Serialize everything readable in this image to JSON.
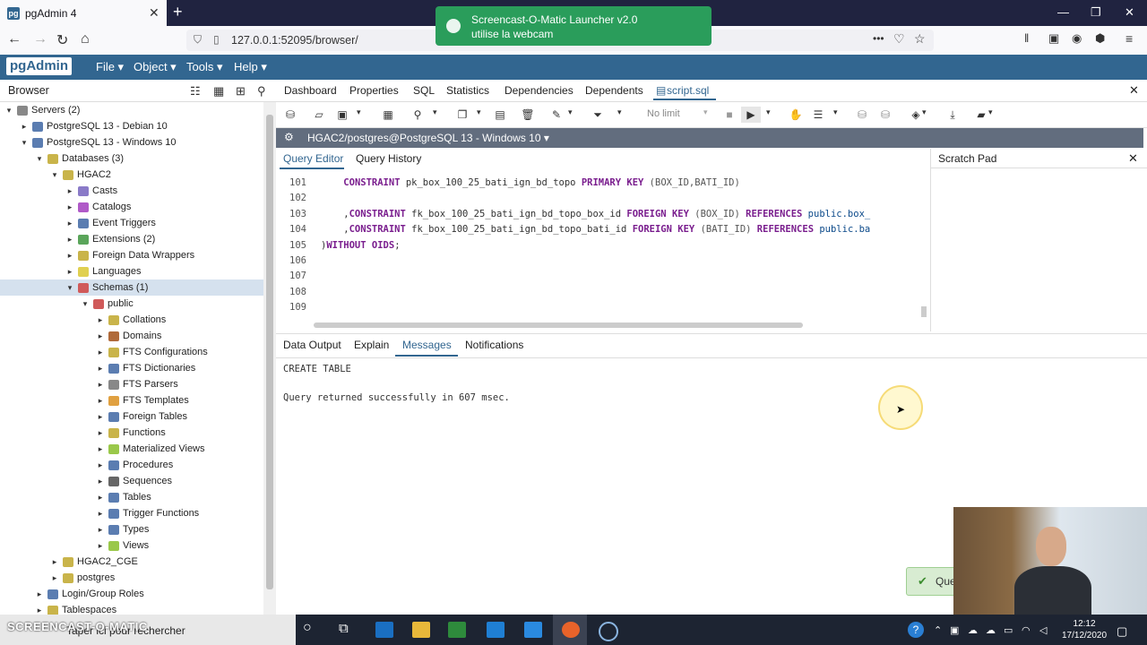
{
  "firefox": {
    "tab_title": "pgAdmin 4",
    "tab_favicon": "pg",
    "url": "127.0.0.1:52095/browser/",
    "more": "•••"
  },
  "notification": {
    "line1": "Screencast-O-Matic Launcher v2.0",
    "line2": "utilise la webcam"
  },
  "pgadmin": {
    "logo_left": "pg",
    "logo_right": "Admin",
    "menu": [
      "File ▾",
      "Object ▾",
      "Tools ▾",
      "Help ▾"
    ]
  },
  "browser": {
    "title": "Browser",
    "tree": [
      {
        "label": "Servers (2)",
        "toggle": "▾",
        "indent": 0,
        "color": "#888"
      },
      {
        "label": "PostgreSQL 13 - Debian 10",
        "toggle": "▸",
        "indent": 1,
        "color": "#5b7db1"
      },
      {
        "label": "PostgreSQL 13 - Windows 10",
        "toggle": "▾",
        "indent": 1,
        "color": "#5b7db1"
      },
      {
        "label": "Databases (3)",
        "toggle": "▾",
        "indent": 2,
        "color": "#c9b44a"
      },
      {
        "label": "HGAC2",
        "toggle": "▾",
        "indent": 3,
        "color": "#c9b44a"
      },
      {
        "label": "Casts",
        "toggle": "▸",
        "indent": 4,
        "color": "#8a7ac8"
      },
      {
        "label": "Catalogs",
        "toggle": "▸",
        "indent": 4,
        "color": "#b05ac8"
      },
      {
        "label": "Event Triggers",
        "toggle": "▸",
        "indent": 4,
        "color": "#5b7db1"
      },
      {
        "label": "Extensions (2)",
        "toggle": "▸",
        "indent": 4,
        "color": "#5aa55a"
      },
      {
        "label": "Foreign Data Wrappers",
        "toggle": "▸",
        "indent": 4,
        "color": "#c9b44a"
      },
      {
        "label": "Languages",
        "toggle": "▸",
        "indent": 4,
        "color": "#e0d050"
      },
      {
        "label": "Schemas (1)",
        "toggle": "▾",
        "indent": 4,
        "color": "#d05a5a",
        "selected": true
      },
      {
        "label": "public",
        "toggle": "▾",
        "indent": 5,
        "color": "#d05a5a"
      },
      {
        "label": "Collations",
        "toggle": "▸",
        "indent": 6,
        "color": "#c9b44a"
      },
      {
        "label": "Domains",
        "toggle": "▸",
        "indent": 6,
        "color": "#b06a3a"
      },
      {
        "label": "FTS Configurations",
        "toggle": "▸",
        "indent": 6,
        "color": "#c9b44a"
      },
      {
        "label": "FTS Dictionaries",
        "toggle": "▸",
        "indent": 6,
        "color": "#5b7db1"
      },
      {
        "label": "FTS Parsers",
        "toggle": "▸",
        "indent": 6,
        "color": "#888"
      },
      {
        "label": "FTS Templates",
        "toggle": "▸",
        "indent": 6,
        "color": "#e0a040"
      },
      {
        "label": "Foreign Tables",
        "toggle": "▸",
        "indent": 6,
        "color": "#5b7db1"
      },
      {
        "label": "Functions",
        "toggle": "▸",
        "indent": 6,
        "color": "#c9b44a"
      },
      {
        "label": "Materialized Views",
        "toggle": "▸",
        "indent": 6,
        "color": "#9ac84a"
      },
      {
        "label": "Procedures",
        "toggle": "▸",
        "indent": 6,
        "color": "#5b7db1"
      },
      {
        "label": "Sequences",
        "toggle": "▸",
        "indent": 6,
        "color": "#666"
      },
      {
        "label": "Tables",
        "toggle": "▸",
        "indent": 6,
        "color": "#5b7db1"
      },
      {
        "label": "Trigger Functions",
        "toggle": "▸",
        "indent": 6,
        "color": "#5b7db1"
      },
      {
        "label": "Types",
        "toggle": "▸",
        "indent": 6,
        "color": "#5b7db1"
      },
      {
        "label": "Views",
        "toggle": "▸",
        "indent": 6,
        "color": "#9ac84a"
      },
      {
        "label": "HGAC2_CGE",
        "toggle": "▸",
        "indent": 3,
        "color": "#c9b44a"
      },
      {
        "label": "postgres",
        "toggle": "▸",
        "indent": 3,
        "color": "#c9b44a"
      },
      {
        "label": "Login/Group Roles",
        "toggle": "▸",
        "indent": 2,
        "color": "#5b7db1"
      },
      {
        "label": "Tablespaces",
        "toggle": "▸",
        "indent": 2,
        "color": "#c9b44a"
      }
    ]
  },
  "main_tabs": [
    "Dashboard",
    "Properties",
    "SQL",
    "Statistics",
    "Dependencies",
    "Dependents"
  ],
  "active_tab": "script.sql",
  "toolbar": {
    "no_limit": "No limit"
  },
  "connection": "HGAC2/postgres@PostgreSQL 13 - Windows 10 ▾",
  "query_tabs": [
    "Query Editor",
    "Query History"
  ],
  "scratch_pad": {
    "title": "Scratch Pad",
    "close": "✕"
  },
  "editor": {
    "lines": [
      {
        "n": "101",
        "parts": [
          [
            "    ",
            ""
          ],
          [
            "CONSTRAINT",
            "kw"
          ],
          [
            " pk_box_100_25_bati_ign_bd_topo ",
            ""
          ],
          [
            "PRIMARY KEY",
            "kw"
          ],
          [
            " (BOX_ID,BATI_ID)",
            "pa"
          ]
        ]
      },
      {
        "n": "102",
        "parts": []
      },
      {
        "n": "103",
        "parts": [
          [
            "    ,",
            ""
          ],
          [
            "CONSTRAINT",
            "kw"
          ],
          [
            " fk_box_100_25_bati_ign_bd_topo_box_id ",
            ""
          ],
          [
            "FOREIGN KEY",
            "kw"
          ],
          [
            " (BOX_ID) ",
            "pa"
          ],
          [
            "REFERENCES",
            "kw"
          ],
          [
            " public.box_",
            "idn"
          ]
        ]
      },
      {
        "n": "104",
        "parts": [
          [
            "    ,",
            ""
          ],
          [
            "CONSTRAINT",
            "kw"
          ],
          [
            " fk_box_100_25_bati_ign_bd_topo_bati_id ",
            ""
          ],
          [
            "FOREIGN KEY",
            "kw"
          ],
          [
            " (BATI_ID) ",
            "pa"
          ],
          [
            "REFERENCES",
            "kw"
          ],
          [
            " public.ba",
            "idn"
          ]
        ]
      },
      {
        "n": "105",
        "parts": [
          [
            ")",
            ""
          ],
          [
            "WITHOUT OIDS",
            "kw"
          ],
          [
            ";",
            ""
          ]
        ]
      },
      {
        "n": "106",
        "parts": []
      },
      {
        "n": "107",
        "parts": []
      },
      {
        "n": "108",
        "parts": []
      },
      {
        "n": "109",
        "parts": []
      }
    ]
  },
  "output_tabs": [
    "Data Output",
    "Explain",
    "Messages",
    "Notifications"
  ],
  "messages": "CREATE TABLE\n\nQuery returned successfully in 607 msec.",
  "query_toast": "Que",
  "taskbar": {
    "search": "Taper ici pour rechercher",
    "watermark": "SCREENCAST-O-MATIC",
    "time": "12:12",
    "date": "17/12/2020"
  }
}
